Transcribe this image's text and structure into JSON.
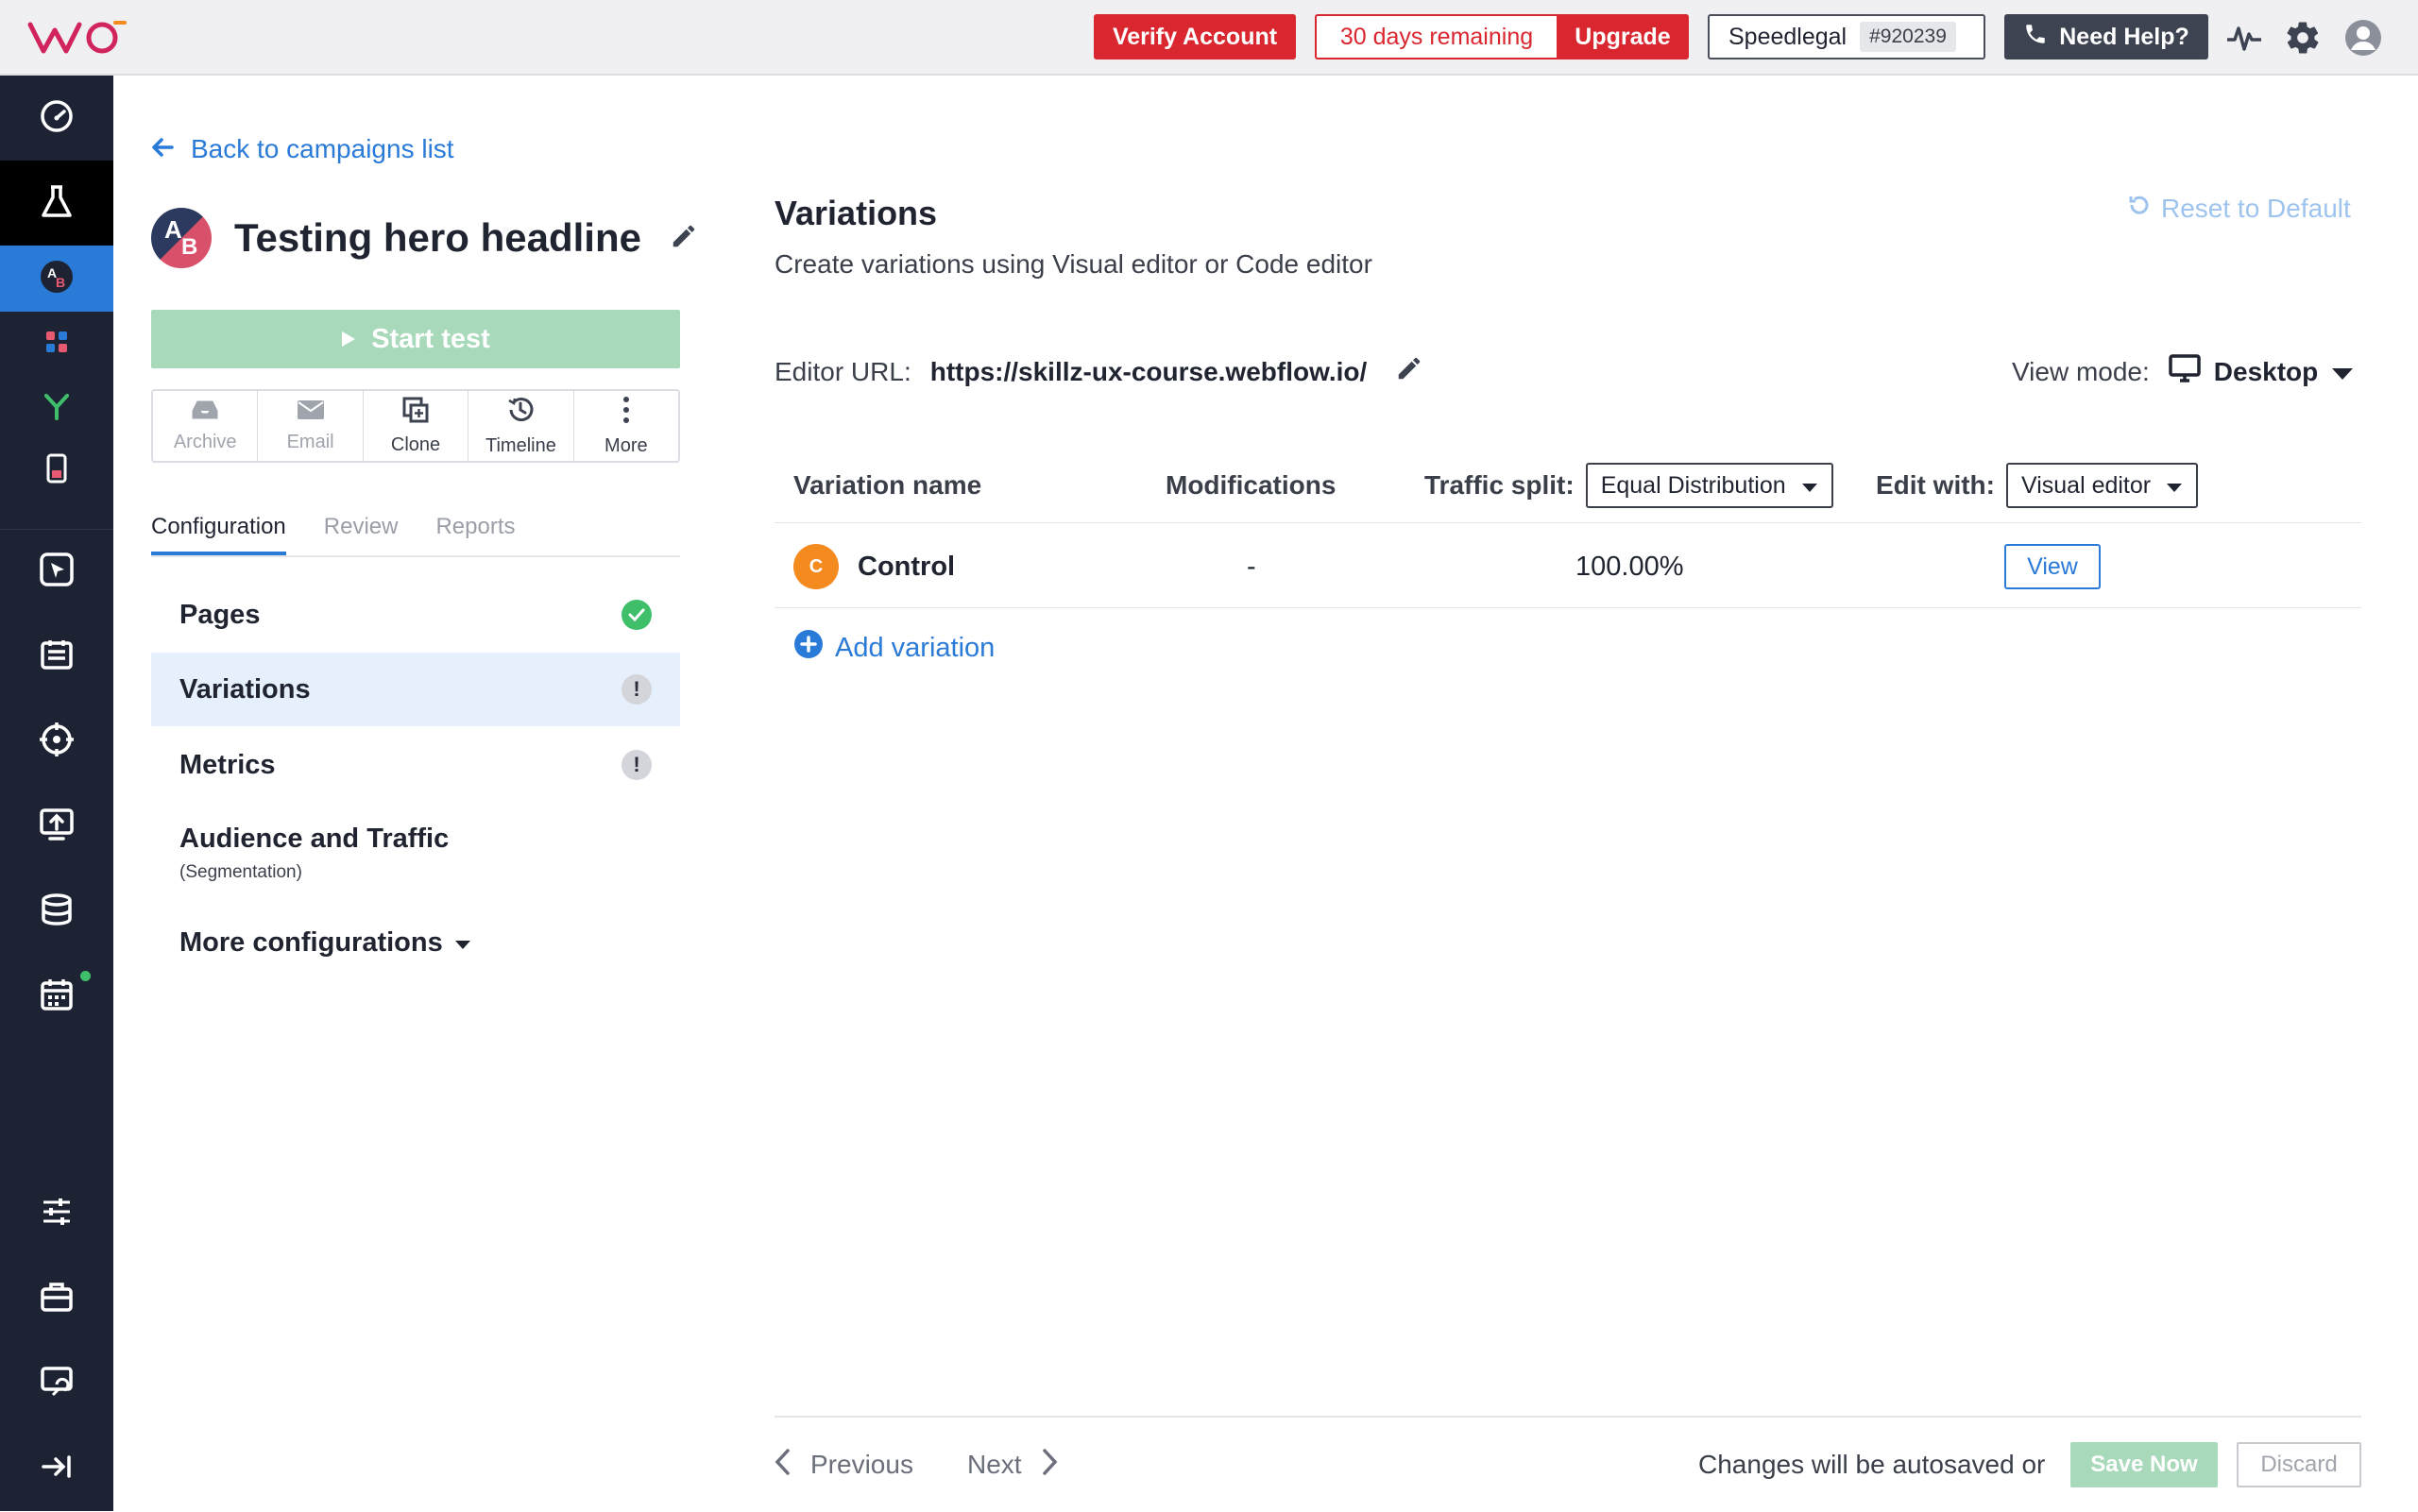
{
  "topbar": {
    "logo_text": "VWO",
    "verify_label": "Verify Account",
    "days_remaining": "30 days remaining",
    "upgrade_label": "Upgrade",
    "account_name": "Speedlegal",
    "account_id": "#920239",
    "help_label": "Need Help?"
  },
  "sidebar": {
    "icons": [
      "dashboard-icon",
      "testing-flask-icon",
      "ab-test-icon",
      "apps-icon",
      "funnel-icon",
      "mobile-icon",
      "heatmap-cursor-icon",
      "survey-form-icon",
      "target-icon",
      "deploy-icon",
      "data-icon",
      "calendar-icon",
      "settings-sliders-icon",
      "toolbox-icon",
      "sync-icon",
      "collapse-icon"
    ]
  },
  "left": {
    "back_label": "Back to campaigns list",
    "avatar_a": "A",
    "avatar_b": "B",
    "campaign_title": "Testing hero headline",
    "start_label": "Start test",
    "actions": {
      "archive": "Archive",
      "email": "Email",
      "clone": "Clone",
      "timeline": "Timeline",
      "more": "More"
    },
    "tabs": {
      "configuration": "Configuration",
      "review": "Review",
      "reports": "Reports"
    },
    "nav": {
      "pages": "Pages",
      "variations": "Variations",
      "metrics": "Metrics",
      "audience": "Audience and Traffic",
      "audience_sub": "(Segmentation)",
      "more_configs": "More configurations"
    },
    "warn_glyph": "!"
  },
  "main": {
    "title": "Variations",
    "subtitle": "Create variations using Visual editor or Code editor",
    "reset_label": "Reset to Default",
    "editor_url_label": "Editor URL:",
    "editor_url": "https://skillz-ux-course.webflow.io/",
    "view_mode_label": "View mode:",
    "view_mode_value": "Desktop",
    "table": {
      "col_name": "Variation name",
      "col_mods": "Modifications",
      "col_traffic": "Traffic split:",
      "traffic_value": "Equal Distribution",
      "col_edit": "Edit with:",
      "edit_value": "Visual editor",
      "rows": [
        {
          "badge": "C",
          "name": "Control",
          "modifications": "-",
          "traffic": "100.00%",
          "action": "View"
        }
      ]
    },
    "add_variation": "Add variation"
  },
  "footer": {
    "previous": "Previous",
    "next": "Next",
    "autosave_note": "Changes will be autosaved or",
    "save_now": "Save Now",
    "discard": "Discard"
  },
  "colors": {
    "accent": "#2a7ad8",
    "danger": "#d9262f",
    "success": "#3fbf6a",
    "sidebar": "#1d2333"
  }
}
